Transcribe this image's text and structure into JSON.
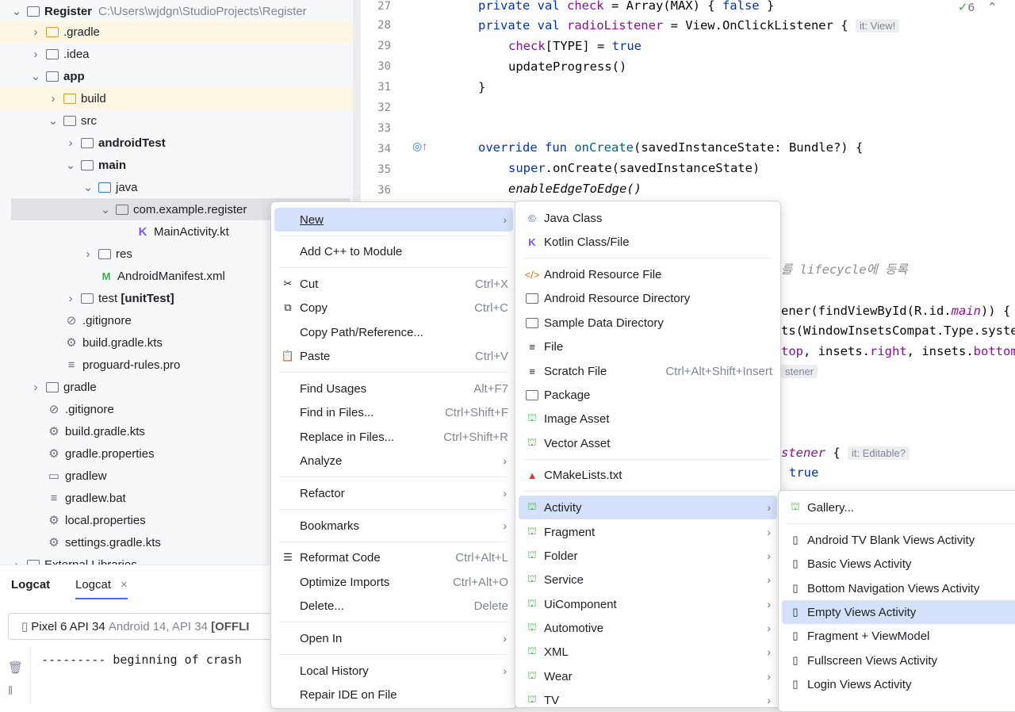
{
  "project_tree": {
    "root": {
      "name": "Register",
      "path": "C:\\Users\\wjdgn\\StudioProjects\\Register"
    },
    "items": [
      {
        "label": ".gradle"
      },
      {
        "label": ".idea"
      },
      {
        "label": "app"
      },
      {
        "label": "build"
      },
      {
        "label": "src"
      },
      {
        "label": "androidTest"
      },
      {
        "label": "main"
      },
      {
        "label": "java"
      },
      {
        "label": "com.example.register"
      },
      {
        "label": "MainActivity.kt"
      },
      {
        "label": "res"
      },
      {
        "label": "AndroidManifest.xml"
      },
      {
        "label": "test",
        "suffix": "[unitTest]"
      },
      {
        "label": ".gitignore"
      },
      {
        "label": "build.gradle.kts"
      },
      {
        "label": "proguard-rules.pro"
      },
      {
        "label": "gradle"
      },
      {
        "label": ".gitignore"
      },
      {
        "label": "build.gradle.kts"
      },
      {
        "label": "gradle.properties"
      },
      {
        "label": "gradlew"
      },
      {
        "label": "gradlew.bat"
      },
      {
        "label": "local.properties"
      },
      {
        "label": "settings.gradle.kts"
      },
      {
        "label": "External Libraries"
      }
    ]
  },
  "logcat": {
    "tab1": "Logcat",
    "tab2": "Logcat",
    "device": "Pixel 6 API 34",
    "device_detail": "Android 14, API 34",
    "device_status": "[OFFLI",
    "log_line": "--------- beginning of crash"
  },
  "editor": {
    "problems_count": "6",
    "line_numbers": [
      "27",
      "28",
      "29",
      "30",
      "31",
      "32",
      "33",
      "34",
      "35",
      "36"
    ],
    "hint_view": "it: View!",
    "hint_editable": "it: Editable?",
    "hint_listener": "stener",
    "code": {
      "l27a": "private val ",
      "l27b": "check",
      "l27c": " = Array(MAX) { ",
      "l27d": "false",
      "l27e": " }",
      "l28a": "private val ",
      "l28b": "radioListener",
      "l28c": " = View.OnClickListener { ",
      "l29a": "check",
      "l29b": "[TYPE] = ",
      "l29c": "true",
      "l30": "updateProgress()",
      "l31": "}",
      "l34a": "override fun ",
      "l34b": "onCreate",
      "l34c": "(savedInstanceState: Bundle?) {",
      "l35a": "super",
      "l35b": ".onCreate(savedInstanceState)",
      "l36": "enableEdgeToEdge()",
      "r1": "를 lifecycle에 등록",
      "r2a": "ener(findViewById(R.id.",
      "r2b": "main",
      "r2c": ")) {",
      "r3": "ts(WindowInsetsCompat.Type.syste",
      "r4a": "top",
      "r4b": ", insets.",
      "r4c": "right",
      "r4d": ", insets.",
      "r4e": "bottom",
      "r5": "stener",
      "r6": "true"
    }
  },
  "context_menu": {
    "items": [
      {
        "label": "New"
      },
      {
        "label": "Add C++ to Module"
      },
      {
        "label": "Cut",
        "shortcut": "Ctrl+X"
      },
      {
        "label": "Copy",
        "shortcut": "Ctrl+C"
      },
      {
        "label": "Copy Path/Reference..."
      },
      {
        "label": "Paste",
        "shortcut": "Ctrl+V"
      },
      {
        "label": "Find Usages",
        "shortcut": "Alt+F7"
      },
      {
        "label": "Find in Files...",
        "shortcut": "Ctrl+Shift+F"
      },
      {
        "label": "Replace in Files...",
        "shortcut": "Ctrl+Shift+R"
      },
      {
        "label": "Analyze"
      },
      {
        "label": "Refactor"
      },
      {
        "label": "Bookmarks"
      },
      {
        "label": "Reformat Code",
        "shortcut": "Ctrl+Alt+L"
      },
      {
        "label": "Optimize Imports",
        "shortcut": "Ctrl+Alt+O"
      },
      {
        "label": "Delete...",
        "shortcut": "Delete"
      },
      {
        "label": "Open In"
      },
      {
        "label": "Local History"
      },
      {
        "label": "Repair IDE on File"
      }
    ]
  },
  "new_menu": {
    "items": [
      {
        "label": "Java Class"
      },
      {
        "label": "Kotlin Class/File"
      },
      {
        "label": "Android Resource File"
      },
      {
        "label": "Android Resource Directory"
      },
      {
        "label": "Sample Data Directory"
      },
      {
        "label": "File"
      },
      {
        "label": "Scratch File",
        "shortcut": "Ctrl+Alt+Shift+Insert"
      },
      {
        "label": "Package"
      },
      {
        "label": "Image Asset"
      },
      {
        "label": "Vector Asset"
      },
      {
        "label": "CMakeLists.txt"
      },
      {
        "label": "Activity"
      },
      {
        "label": "Fragment"
      },
      {
        "label": "Folder"
      },
      {
        "label": "Service"
      },
      {
        "label": "UiComponent"
      },
      {
        "label": "Automotive"
      },
      {
        "label": "XML"
      },
      {
        "label": "Wear"
      },
      {
        "label": "TV"
      }
    ]
  },
  "activity_menu": {
    "items": [
      {
        "label": "Gallery..."
      },
      {
        "label": "Android TV Blank Views Activity"
      },
      {
        "label": "Basic Views Activity"
      },
      {
        "label": "Bottom Navigation Views Activity"
      },
      {
        "label": "Empty Views Activity"
      },
      {
        "label": "Fragment + ViewModel"
      },
      {
        "label": "Fullscreen Views Activity"
      },
      {
        "label": "Login Views Activity"
      }
    ]
  },
  "colors": {
    "accent": "#3574f0",
    "selected_menu": "#d5e1fa",
    "android_green": "#45a84e",
    "highlight": "#fdf6e3"
  }
}
